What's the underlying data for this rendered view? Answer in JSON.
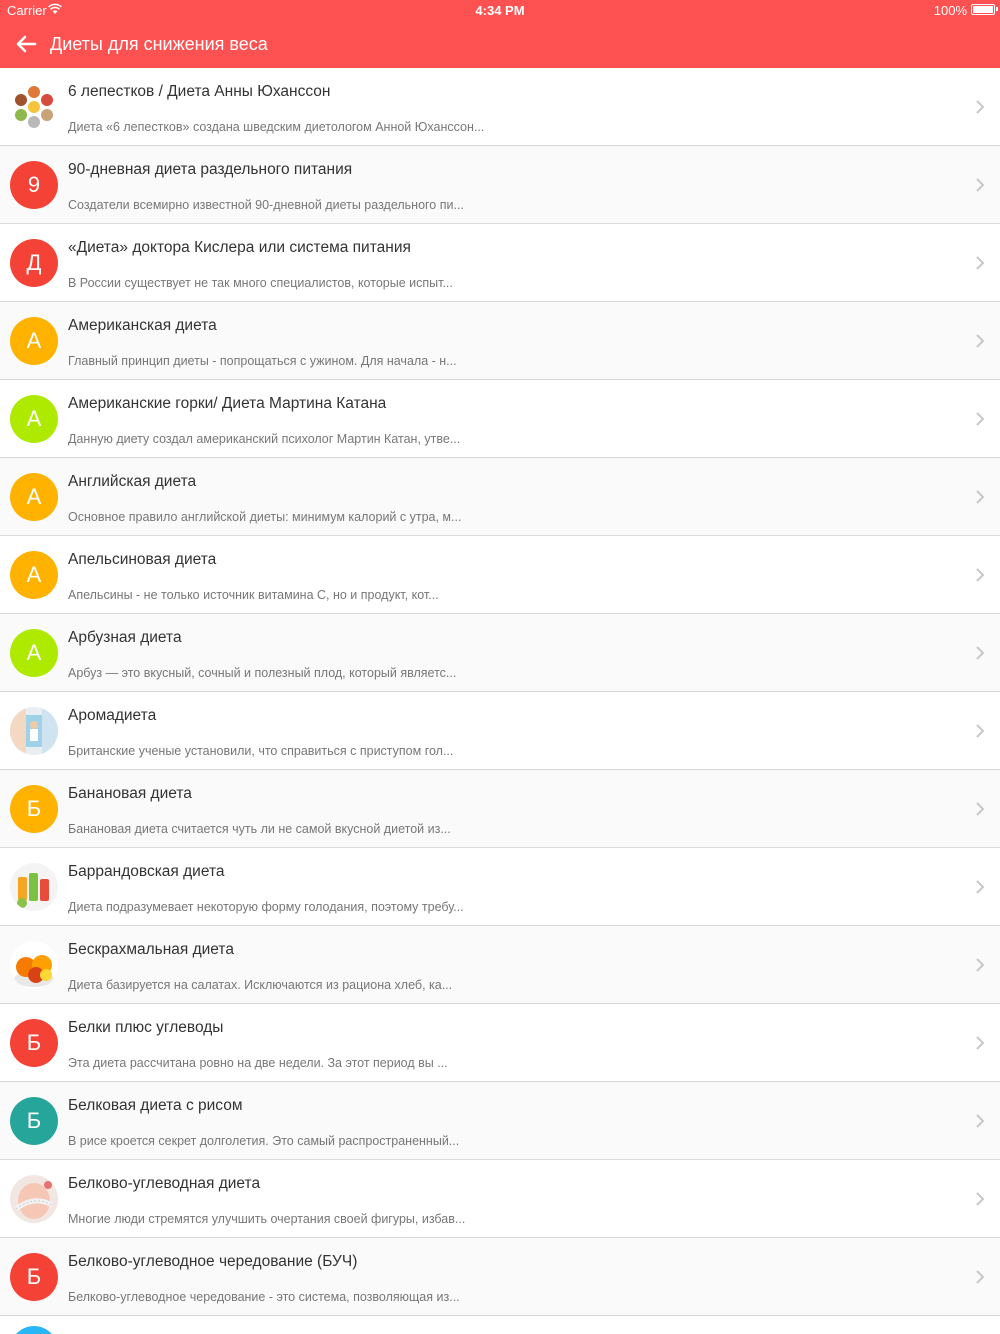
{
  "status_bar": {
    "carrier": "Carrier",
    "time": "4:34 PM",
    "battery": "100%"
  },
  "nav": {
    "title": "Диеты для снижения веса"
  },
  "items": [
    {
      "title": "6 лепестков / Диета Анны Юханссон",
      "subtitle": "Диета «6 лепестков» создана шведским диетологом Анной Юханссон...",
      "letter": "",
      "color": "",
      "image": "petals"
    },
    {
      "title": "90-дневная диета раздельного питания",
      "subtitle": "Создатели всемирно известной 90-дневной диеты раздельного пи...",
      "letter": "9",
      "color": "#f44336",
      "image": ""
    },
    {
      "title": "«Диета» доктора Кислера или система питания",
      "subtitle": "В России существует не так много специалистов, которые испыт...",
      "letter": "Д",
      "color": "#f44336",
      "image": ""
    },
    {
      "title": "Американская диета",
      "subtitle": "Главный принцип диеты - попрощаться с ужином. Для начала - н...",
      "letter": "А",
      "color": "#ffb300",
      "image": ""
    },
    {
      "title": "Американские горки/ Диета Мартина Катана",
      "subtitle": "Данную диету создал американский психолог Мартин Катан, утве...",
      "letter": "А",
      "color": "#aeea00",
      "image": ""
    },
    {
      "title": "Английская диета",
      "subtitle": "Основное правило английской диеты: минимум калорий с утра, м...",
      "letter": "А",
      "color": "#ffb300",
      "image": ""
    },
    {
      "title": "Апельсиновая диета",
      "subtitle": "Апельсины - не только источник витамина С, но и продукт, кот...",
      "letter": "А",
      "color": "#ffb300",
      "image": ""
    },
    {
      "title": "Арбузная диета",
      "subtitle": "Арбуз — это вкусный, сочный и полезный плод, который являетс...",
      "letter": "А",
      "color": "#aeea00",
      "image": ""
    },
    {
      "title": "Аромадиета",
      "subtitle": "Британские ученые установили, что справиться с приступом гол...",
      "letter": "",
      "color": "",
      "image": "aroma"
    },
    {
      "title": "Банановая диета",
      "subtitle": "Банановая диета считается чуть ли не самой вкусной диетой из...",
      "letter": "Б",
      "color": "#ffb300",
      "image": ""
    },
    {
      "title": "Баррандовская диета",
      "subtitle": "Диета подразумевает некоторую форму голодания, поэтому требу...",
      "letter": "",
      "color": "",
      "image": "juices"
    },
    {
      "title": "Бескрахмальная диета",
      "subtitle": "Диета базируется на салатах. Исключаются из рациона хлеб, ка...",
      "letter": "",
      "color": "",
      "image": "fruits"
    },
    {
      "title": "Белки плюс углеводы",
      "subtitle": "Эта диета рассчитана ровно на две недели. За этот период вы ...",
      "letter": "Б",
      "color": "#f44336",
      "image": ""
    },
    {
      "title": "Белковая диета с рисом",
      "subtitle": "В рисе кроется секрет долголетия. Это самый распространенный...",
      "letter": "Б",
      "color": "#26a69a",
      "image": ""
    },
    {
      "title": "Белково-углеводная диета",
      "subtitle": "Многие люди стремятся улучшить очертания своей фигуры, избав...",
      "letter": "",
      "color": "",
      "image": "measure"
    },
    {
      "title": "Белково-углеводное чередование (БУЧ)",
      "subtitle": "Белково-углеводное чередование - это система, позволяющая из...",
      "letter": "Б",
      "color": "#f44336",
      "image": ""
    }
  ],
  "colors": {
    "header": "#fe5252",
    "chevron": "#c7c7cc",
    "divider": "#d8d8d8"
  }
}
